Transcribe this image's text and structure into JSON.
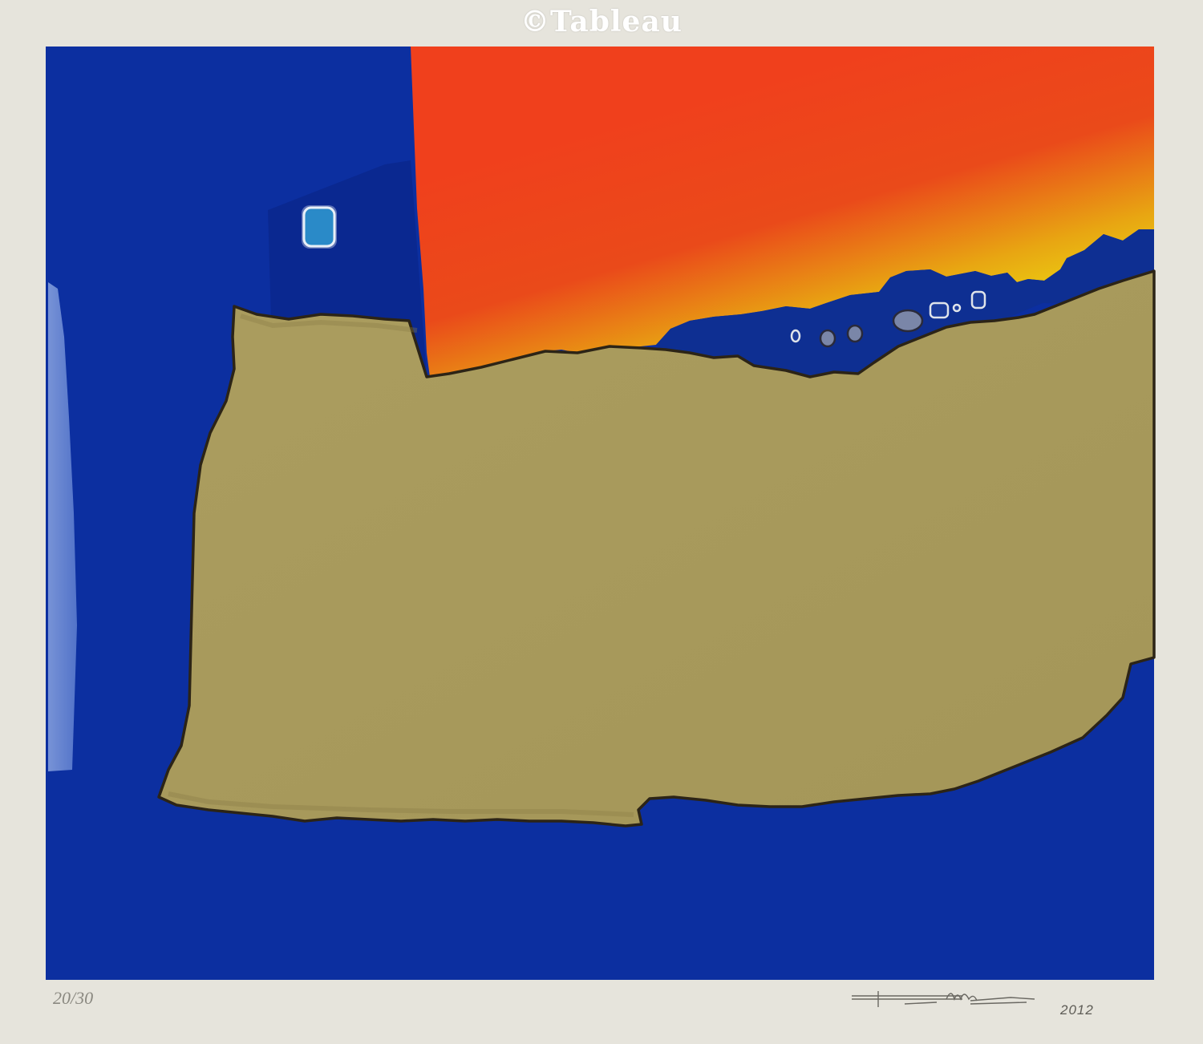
{
  "watermark": {
    "text": "©Tableau"
  },
  "print": {
    "edition_number": "20/30",
    "signature_year": "2012",
    "signature": "handwritten-signature"
  },
  "colors": {
    "paper": "#e6e4dc",
    "blue_field": "#0c2fa0",
    "ochre_shape": "#a89a5c",
    "outline": "#2c2416",
    "red_orange": "#f0401c",
    "yellow": "#ecdc10",
    "light_blue_square": "#2a8ac8"
  }
}
